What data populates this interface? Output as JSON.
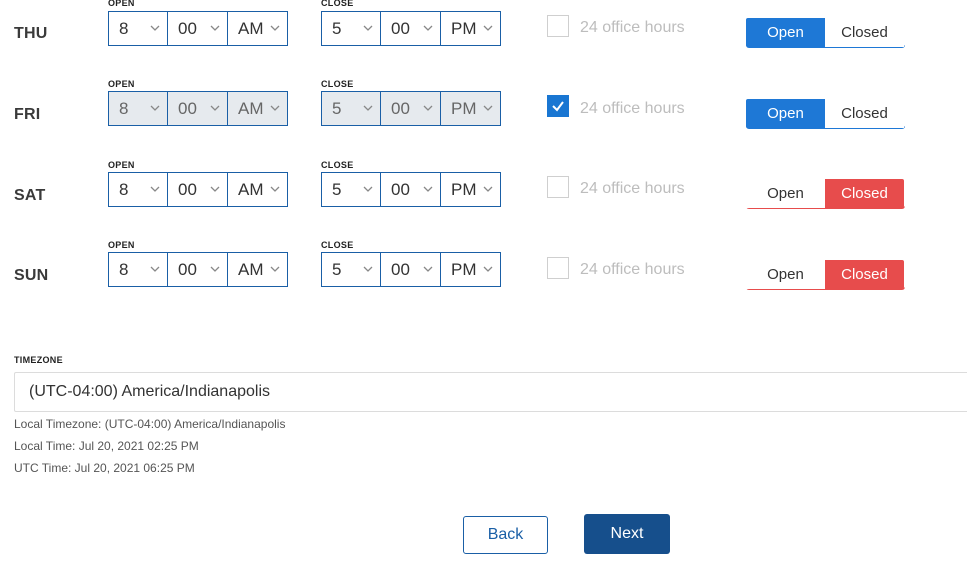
{
  "days": [
    {
      "label": "THU",
      "open_label": "OPEN",
      "close_label": "CLOSE",
      "open_hour": "8",
      "open_min": "00",
      "open_ampm": "AM",
      "close_hour": "5",
      "close_min": "00",
      "close_ampm": "PM",
      "all_day_label": "24 office hours",
      "all_day_checked": false,
      "open_btn": "Open",
      "closed_btn": "Closed",
      "status": "open"
    },
    {
      "label": "FRI",
      "open_label": "OPEN",
      "close_label": "CLOSE",
      "open_hour": "8",
      "open_min": "00",
      "open_ampm": "AM",
      "close_hour": "5",
      "close_min": "00",
      "close_ampm": "PM",
      "all_day_label": "24 office hours",
      "all_day_checked": true,
      "open_btn": "Open",
      "closed_btn": "Closed",
      "status": "open"
    },
    {
      "label": "SAT",
      "open_label": "OPEN",
      "close_label": "CLOSE",
      "open_hour": "8",
      "open_min": "00",
      "open_ampm": "AM",
      "close_hour": "5",
      "close_min": "00",
      "close_ampm": "PM",
      "all_day_label": "24 office hours",
      "all_day_checked": false,
      "open_btn": "Open",
      "closed_btn": "Closed",
      "status": "closed"
    },
    {
      "label": "SUN",
      "open_label": "OPEN",
      "close_label": "CLOSE",
      "open_hour": "8",
      "open_min": "00",
      "open_ampm": "AM",
      "close_hour": "5",
      "close_min": "00",
      "close_ampm": "PM",
      "all_day_label": "24 office hours",
      "all_day_checked": false,
      "open_btn": "Open",
      "closed_btn": "Closed",
      "status": "closed"
    }
  ],
  "timezone": {
    "label": "TIMEZONE",
    "value": "(UTC-04:00) America/Indianapolis",
    "local_timezone": "Local Timezone: (UTC-04:00) America/Indianapolis",
    "local_time": "Local Time: Jul 20, 2021 02:25 PM",
    "utc_time": "UTC Time: Jul 20, 2021 06:25 PM"
  },
  "buttons": {
    "back": "Back",
    "next": "Next"
  },
  "colors": {
    "primary": "#1e78d6",
    "border": "#1a5fa6",
    "danger": "#e74c4c",
    "next_bg": "#164f8c",
    "disabled_bg": "#e6eaee"
  },
  "icons": {
    "chevron": "chevron-down-icon",
    "check": "check-icon"
  }
}
